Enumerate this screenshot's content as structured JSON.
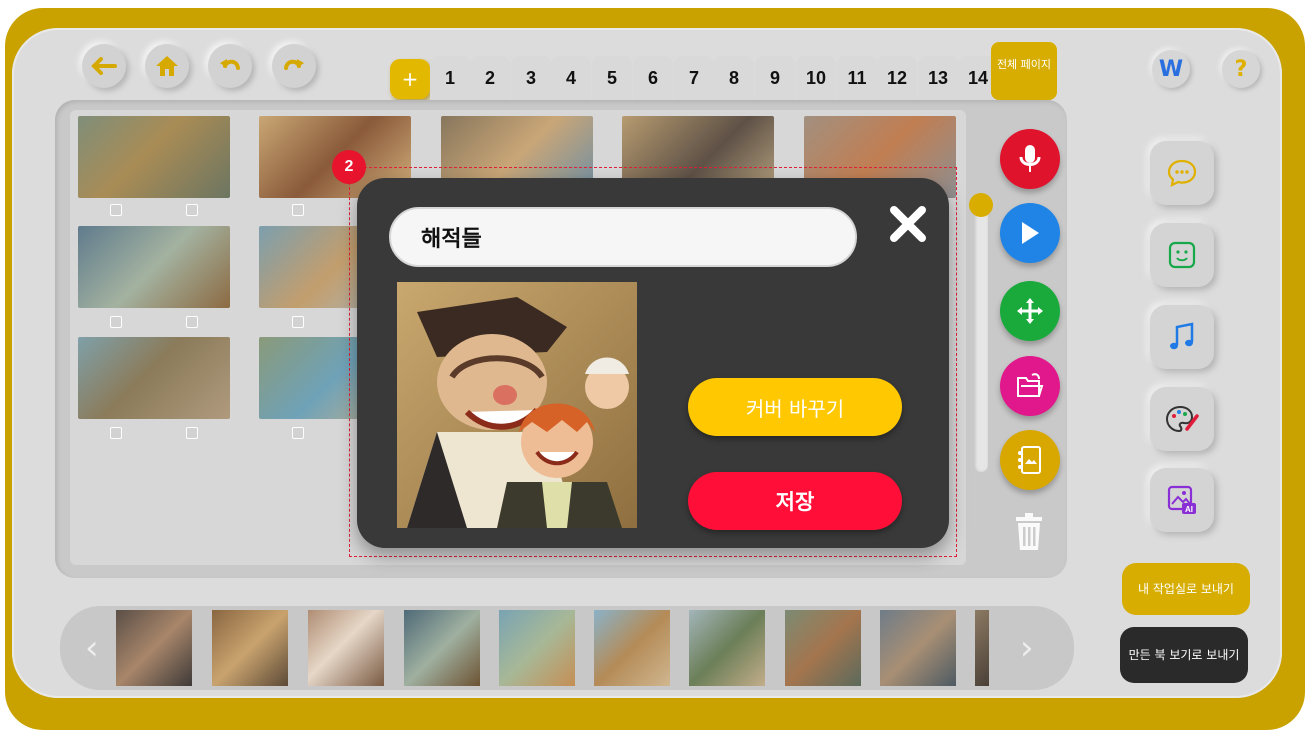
{
  "toolbar": {
    "back_icon": "arrow-left-icon",
    "home_icon": "home-icon",
    "undo_icon": "undo-icon",
    "redo_icon": "redo-icon",
    "add_page_label": "+",
    "all_pages_label": "전체 페이지",
    "w_label": "W",
    "help_label": "?",
    "accent": "#d6ad00"
  },
  "pages": [
    "1",
    "2",
    "3",
    "4",
    "5",
    "6",
    "7",
    "8",
    "9",
    "10",
    "11",
    "12",
    "13",
    "14"
  ],
  "side_tools": [
    {
      "name": "mic",
      "color": "#e0132d"
    },
    {
      "name": "play",
      "color": "#1f84e6"
    },
    {
      "name": "move",
      "color": "#1aaa3c"
    },
    {
      "name": "folder",
      "color": "#e0188c"
    },
    {
      "name": "album",
      "color": "#d8a800"
    }
  ],
  "right_tools": [
    "chat-icon",
    "sticker-icon",
    "music-icon",
    "palette-icon",
    "ai-image-icon"
  ],
  "actions": {
    "send_work": "내 작업실로 보내기",
    "send_book": "만든 북 보기로 보내기"
  },
  "annotation": {
    "number": "2"
  },
  "modal": {
    "title_value": "해적들",
    "change_cover": "커버 바꾸기",
    "save": "저장",
    "close_icon": "close-icon"
  }
}
